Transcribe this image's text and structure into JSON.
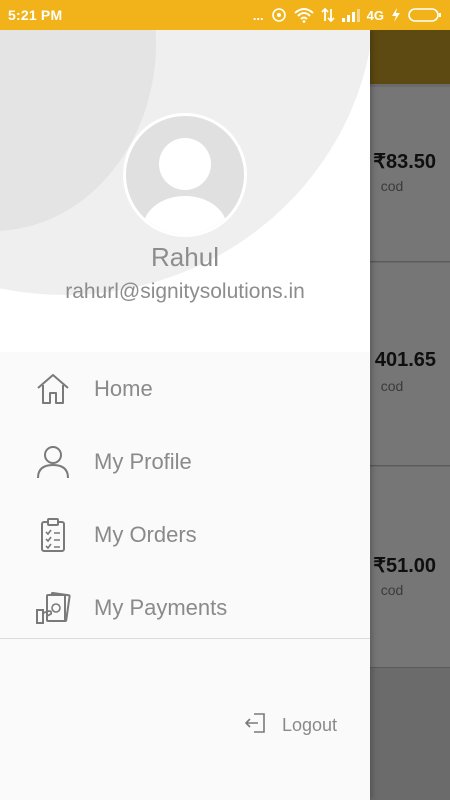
{
  "status_bar": {
    "time": "5:21 PM",
    "dots": "...",
    "network": "4G"
  },
  "drawer": {
    "user": {
      "name": "Rahul",
      "email": "rahurl@signitysolutions.in"
    },
    "menu": [
      {
        "label": "Home",
        "icon": "home-icon"
      },
      {
        "label": "My Profile",
        "icon": "person-icon"
      },
      {
        "label": "My Orders",
        "icon": "clipboard-icon"
      },
      {
        "label": "My Payments",
        "icon": "payment-icon"
      }
    ],
    "logout": {
      "label": "Logout",
      "icon": "logout-icon"
    }
  },
  "background_orders": [
    {
      "amount": "₹83.50",
      "payment": "cod"
    },
    {
      "amount": "401.65",
      "payment": "cod"
    },
    {
      "amount": "₹51.00",
      "payment": "cod"
    }
  ],
  "colors": {
    "status_bar": "#f1b319",
    "toolbar": "#5d4a12",
    "drawer_text": "#8a8a8a"
  }
}
